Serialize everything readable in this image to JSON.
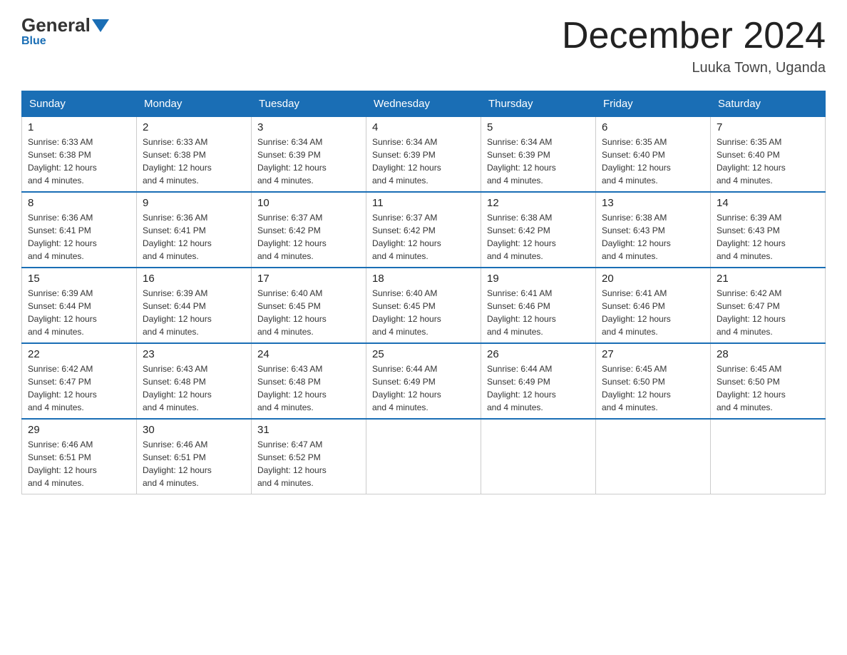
{
  "logo": {
    "general": "General",
    "blue": "Blue"
  },
  "header": {
    "month_title": "December 2024",
    "location": "Luuka Town, Uganda"
  },
  "days_of_week": [
    "Sunday",
    "Monday",
    "Tuesday",
    "Wednesday",
    "Thursday",
    "Friday",
    "Saturday"
  ],
  "weeks": [
    [
      {
        "day": "1",
        "sunrise": "6:33 AM",
        "sunset": "6:38 PM",
        "daylight": "12 hours and 4 minutes."
      },
      {
        "day": "2",
        "sunrise": "6:33 AM",
        "sunset": "6:38 PM",
        "daylight": "12 hours and 4 minutes."
      },
      {
        "day": "3",
        "sunrise": "6:34 AM",
        "sunset": "6:39 PM",
        "daylight": "12 hours and 4 minutes."
      },
      {
        "day": "4",
        "sunrise": "6:34 AM",
        "sunset": "6:39 PM",
        "daylight": "12 hours and 4 minutes."
      },
      {
        "day": "5",
        "sunrise": "6:34 AM",
        "sunset": "6:39 PM",
        "daylight": "12 hours and 4 minutes."
      },
      {
        "day": "6",
        "sunrise": "6:35 AM",
        "sunset": "6:40 PM",
        "daylight": "12 hours and 4 minutes."
      },
      {
        "day": "7",
        "sunrise": "6:35 AM",
        "sunset": "6:40 PM",
        "daylight": "12 hours and 4 minutes."
      }
    ],
    [
      {
        "day": "8",
        "sunrise": "6:36 AM",
        "sunset": "6:41 PM",
        "daylight": "12 hours and 4 minutes."
      },
      {
        "day": "9",
        "sunrise": "6:36 AM",
        "sunset": "6:41 PM",
        "daylight": "12 hours and 4 minutes."
      },
      {
        "day": "10",
        "sunrise": "6:37 AM",
        "sunset": "6:42 PM",
        "daylight": "12 hours and 4 minutes."
      },
      {
        "day": "11",
        "sunrise": "6:37 AM",
        "sunset": "6:42 PM",
        "daylight": "12 hours and 4 minutes."
      },
      {
        "day": "12",
        "sunrise": "6:38 AM",
        "sunset": "6:42 PM",
        "daylight": "12 hours and 4 minutes."
      },
      {
        "day": "13",
        "sunrise": "6:38 AM",
        "sunset": "6:43 PM",
        "daylight": "12 hours and 4 minutes."
      },
      {
        "day": "14",
        "sunrise": "6:39 AM",
        "sunset": "6:43 PM",
        "daylight": "12 hours and 4 minutes."
      }
    ],
    [
      {
        "day": "15",
        "sunrise": "6:39 AM",
        "sunset": "6:44 PM",
        "daylight": "12 hours and 4 minutes."
      },
      {
        "day": "16",
        "sunrise": "6:39 AM",
        "sunset": "6:44 PM",
        "daylight": "12 hours and 4 minutes."
      },
      {
        "day": "17",
        "sunrise": "6:40 AM",
        "sunset": "6:45 PM",
        "daylight": "12 hours and 4 minutes."
      },
      {
        "day": "18",
        "sunrise": "6:40 AM",
        "sunset": "6:45 PM",
        "daylight": "12 hours and 4 minutes."
      },
      {
        "day": "19",
        "sunrise": "6:41 AM",
        "sunset": "6:46 PM",
        "daylight": "12 hours and 4 minutes."
      },
      {
        "day": "20",
        "sunrise": "6:41 AM",
        "sunset": "6:46 PM",
        "daylight": "12 hours and 4 minutes."
      },
      {
        "day": "21",
        "sunrise": "6:42 AM",
        "sunset": "6:47 PM",
        "daylight": "12 hours and 4 minutes."
      }
    ],
    [
      {
        "day": "22",
        "sunrise": "6:42 AM",
        "sunset": "6:47 PM",
        "daylight": "12 hours and 4 minutes."
      },
      {
        "day": "23",
        "sunrise": "6:43 AM",
        "sunset": "6:48 PM",
        "daylight": "12 hours and 4 minutes."
      },
      {
        "day": "24",
        "sunrise": "6:43 AM",
        "sunset": "6:48 PM",
        "daylight": "12 hours and 4 minutes."
      },
      {
        "day": "25",
        "sunrise": "6:44 AM",
        "sunset": "6:49 PM",
        "daylight": "12 hours and 4 minutes."
      },
      {
        "day": "26",
        "sunrise": "6:44 AM",
        "sunset": "6:49 PM",
        "daylight": "12 hours and 4 minutes."
      },
      {
        "day": "27",
        "sunrise": "6:45 AM",
        "sunset": "6:50 PM",
        "daylight": "12 hours and 4 minutes."
      },
      {
        "day": "28",
        "sunrise": "6:45 AM",
        "sunset": "6:50 PM",
        "daylight": "12 hours and 4 minutes."
      }
    ],
    [
      {
        "day": "29",
        "sunrise": "6:46 AM",
        "sunset": "6:51 PM",
        "daylight": "12 hours and 4 minutes."
      },
      {
        "day": "30",
        "sunrise": "6:46 AM",
        "sunset": "6:51 PM",
        "daylight": "12 hours and 4 minutes."
      },
      {
        "day": "31",
        "sunrise": "6:47 AM",
        "sunset": "6:52 PM",
        "daylight": "12 hours and 4 minutes."
      },
      null,
      null,
      null,
      null
    ]
  ],
  "labels": {
    "sunrise": "Sunrise:",
    "sunset": "Sunset:",
    "daylight": "Daylight: 12 hours"
  }
}
